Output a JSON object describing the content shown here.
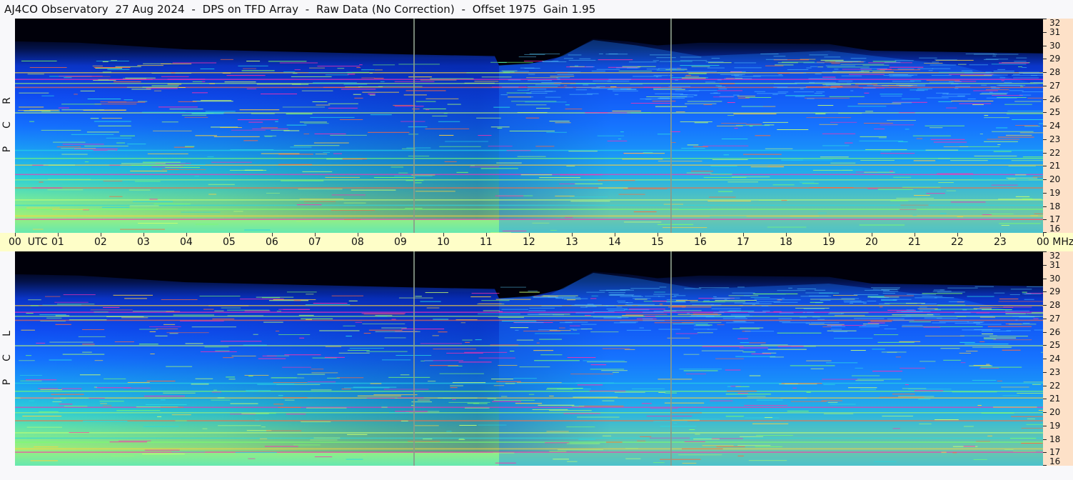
{
  "title": "AJ4CO Observatory  27 Aug 2024  -  DPS on TFD Array  -  Raw Data (No Correction)  -  Offset 1975  Gain 1.95",
  "colors": {
    "background": "#f8f8fa",
    "time_axis_bg": "#fefec8",
    "freq_axis_bg": "#fde1c8",
    "spectrogram_low": "#000010",
    "spectrogram_mid": "#0a3cff",
    "spectrogram_high": "#7cff6a",
    "spectrogram_peak": "#ff2fb0"
  },
  "chart_data": [
    {
      "type": "heatmap",
      "name": "R C P",
      "polarization_label": [
        "R",
        "C",
        "P"
      ],
      "x_unit": "UTC",
      "y_unit": "MHz",
      "xlim": [
        0,
        24
      ],
      "ylim": [
        16,
        32
      ],
      "x_tick_labels": [
        "00",
        "01",
        "02",
        "03",
        "04",
        "05",
        "06",
        "07",
        "08",
        "09",
        "10",
        "11",
        "12",
        "13",
        "14",
        "15",
        "16",
        "17",
        "18",
        "19",
        "20",
        "21",
        "22",
        "23",
        "00"
      ],
      "y_tick_labels": [
        "16",
        "17",
        "18",
        "19",
        "20",
        "21",
        "22",
        "23",
        "24",
        "25",
        "26",
        "27",
        "28",
        "29",
        "30",
        "31",
        "32"
      ],
      "time_markers_utc": [
        9.3,
        15.3
      ],
      "notes": "Dynamic spectrum; dark (low intensity) above ~29 MHz, brighter toward lower frequencies; bright emission rise ~12-15 UTC; persistent interference lines near 17-18, 25, 27 MHz."
    },
    {
      "type": "heatmap",
      "name": "L C P",
      "polarization_label": [
        "L",
        "C",
        "P"
      ],
      "x_unit": "UTC",
      "y_unit": "MHz",
      "xlim": [
        0,
        24
      ],
      "ylim": [
        16,
        32
      ],
      "x_tick_labels": [
        "00",
        "01",
        "02",
        "03",
        "04",
        "05",
        "06",
        "07",
        "08",
        "09",
        "10",
        "11",
        "12",
        "13",
        "14",
        "15",
        "16",
        "17",
        "18",
        "19",
        "20",
        "21",
        "22",
        "23",
        "00"
      ],
      "y_tick_labels": [
        "16",
        "17",
        "18",
        "19",
        "20",
        "21",
        "22",
        "23",
        "24",
        "25",
        "26",
        "27",
        "28",
        "29",
        "30",
        "31",
        "32"
      ],
      "time_markers_utc": [
        9.3,
        15.3
      ],
      "notes": "Left circular polarization spectrum with similar structure to RCP."
    }
  ],
  "time_axis": {
    "utc_label": "UTC",
    "mhz_label": "MHz"
  }
}
